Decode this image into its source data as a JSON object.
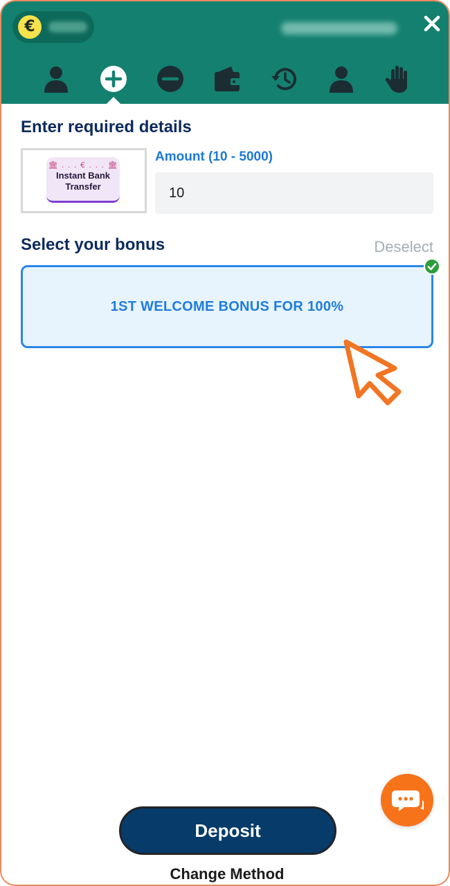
{
  "colors": {
    "header": "#14806f",
    "accent_blue": "#1f7ddd",
    "deposit": "#063b6a",
    "chat": "#f7731a",
    "frame_border": "#e88a5c"
  },
  "header": {
    "currency_symbol": "€",
    "close_symbol": "✕",
    "nav": [
      {
        "name": "profile",
        "icon": "user-icon"
      },
      {
        "name": "deposit",
        "icon": "plus-circle-icon",
        "active": true
      },
      {
        "name": "withdraw",
        "icon": "minus-circle-icon"
      },
      {
        "name": "wallet",
        "icon": "wallet-icon"
      },
      {
        "name": "history",
        "icon": "history-icon"
      },
      {
        "name": "account",
        "icon": "user-icon"
      },
      {
        "name": "responsible-gaming",
        "icon": "hand-icon"
      }
    ]
  },
  "details": {
    "title": "Enter required details",
    "method": {
      "deco": "🏛 . . . € . . . 🏛",
      "line1": "Instant Bank",
      "line2": "Transfer"
    },
    "amount_label": "Amount (10 - 5000)",
    "amount_value": "10"
  },
  "bonus": {
    "title": "Select your bonus",
    "deselect_label": "Deselect",
    "selected_bonus": "1ST WELCOME BONUS FOR 100%"
  },
  "footer": {
    "deposit_label": "Deposit",
    "change_method_label": "Change Method"
  }
}
